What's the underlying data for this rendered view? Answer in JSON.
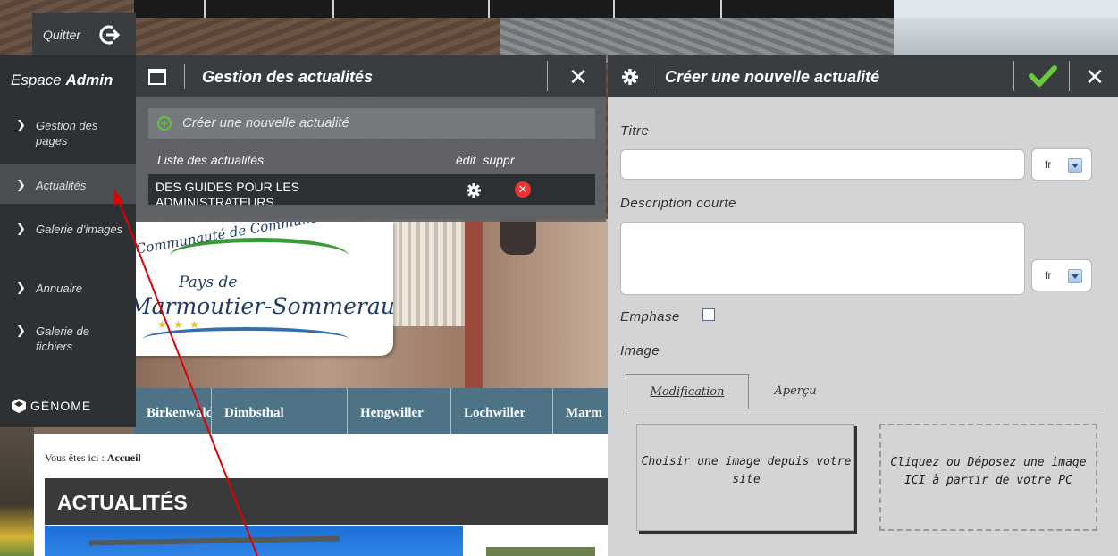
{
  "admin": {
    "quit_label": "Quitter",
    "space_title_prefix": "Espace",
    "space_title_bold": "Admin",
    "menu": [
      {
        "label": "Gestion des pages",
        "active": false
      },
      {
        "label": "Actualités",
        "active": true
      },
      {
        "label": "Galerie d'images",
        "active": false
      },
      {
        "label": "Annuaire",
        "active": false
      },
      {
        "label": "Galerie de fichiers",
        "active": false
      }
    ],
    "brand": "GÉNOME"
  },
  "news_manager": {
    "title": "Gestion des actualités",
    "create_link": "Créer une nouvelle actualité",
    "list_title": "Liste des actualités",
    "col_edit": "édit",
    "col_delete": "suppr",
    "rows": [
      {
        "title": "DES GUIDES POUR LES ADMINISTRATEURS"
      }
    ]
  },
  "create_form": {
    "title": "Créer une nouvelle actualité",
    "title_label": "Titre",
    "title_value": "",
    "title_lang": "fr",
    "desc_label": "Description courte",
    "desc_value": "",
    "desc_lang": "fr",
    "emphasis_label": "Emphase",
    "emphasis_checked": false,
    "image_label": "Image",
    "tabs": [
      {
        "label": "Modification",
        "active": true
      },
      {
        "label": "Aperçu",
        "active": false
      }
    ],
    "choose_image": "Choisir une image depuis votre site",
    "drop_image": "Cliquez ou Déposez une image ICI à partir de votre PC"
  },
  "site": {
    "logo_line1": "Communauté de Communes",
    "logo_line2": "Pays de",
    "logo_line3": "Marmoutier-Sommerau",
    "nav": [
      "Birkenwald",
      "Dimbsthal",
      "Hengwiller",
      "Lochwiller",
      "Marm"
    ],
    "breadcrumb_prefix": "Vous êtes ici :",
    "breadcrumb_current": "Accueil",
    "banner": "ACTUALITÉS"
  },
  "colors": {
    "panel_dark": "#3a3d40",
    "sidebar": "#2e3134",
    "accent_green": "#5fc23a",
    "delete_red": "#e33333",
    "annotation_arrow": "#e00000"
  }
}
